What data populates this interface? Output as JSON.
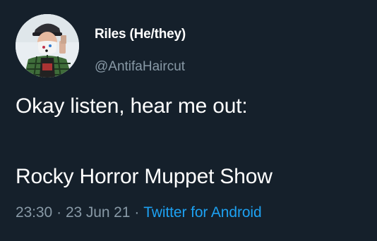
{
  "user": {
    "display_name": "Riles (He/they)",
    "handle": "@AntifaHaircut"
  },
  "tweet": {
    "line1": "Okay listen, hear me out:",
    "line2": "Rocky Horror Muppet Show"
  },
  "meta": {
    "time": "23:30",
    "date": "23 Jun 21",
    "separator": "·",
    "source": "Twitter for Android"
  },
  "colors": {
    "background": "#15202b",
    "text": "#ffffff",
    "secondary": "#8899a6",
    "link": "#1da1f2"
  }
}
